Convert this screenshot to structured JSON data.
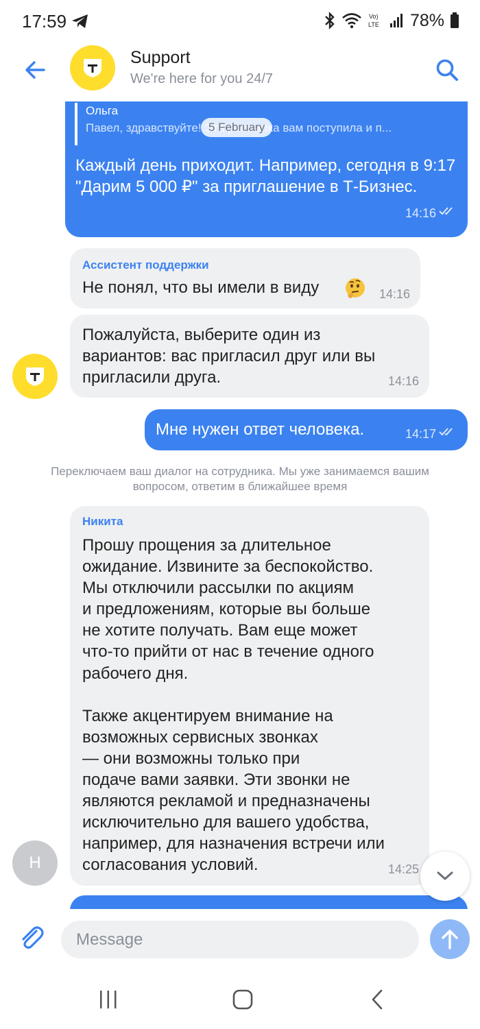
{
  "status_bar": {
    "time": "17:59",
    "battery": "78%",
    "icons": [
      "telegram-icon",
      "bluetooth-icon",
      "wifi-icon",
      "volte-icon",
      "signal-icon",
      "battery-icon"
    ]
  },
  "header": {
    "title": "Support",
    "subtitle": "We're here for you 24/7",
    "icons": [
      "back-arrow-icon",
      "shield-logo-icon",
      "search-icon"
    ]
  },
  "date_separator": "5 February",
  "messages": [
    {
      "direction": "out",
      "quote_author": "Ольга",
      "quote_text": "Павел, здравствуйте! Эта рассылка вам поступила и п...",
      "text": "Каждый день приходит. Например, сегодня в 9:17 \"Дарим 5 000 ₽\" за приглашение в Т-Бизнес.",
      "time": "14:16",
      "status": "read"
    },
    {
      "direction": "in",
      "sender": "Ассистент поддержки",
      "text": "Не понял, что вы имели в виду",
      "emoji": "thinking-face",
      "time": "14:16"
    },
    {
      "direction": "in",
      "text": "Пожалуйста, выберите один из вариантов: вас пригласил друг или вы пригласили друга.",
      "time": "14:16"
    },
    {
      "direction": "out",
      "text": "Мне нужен ответ человека.",
      "time": "14:17",
      "status": "read"
    },
    {
      "direction": "in",
      "sender": "Никита",
      "text": "Прошу прощения за длительное\nожидание. Извините за беспокойство.\nМы отключили рассылки по акциям\nи предложениям, которые вы больше\nне хотите получать. Вам еще может\nчто-то прийти от нас в течение одного\nрабочего дня.\n\nТакже акцентируем внимание на\nвозможных сервисных звонках\n— они возможны только при\nподаче вами заявки. Эти звонки не\nявляются рекламой и предназначены\nисключительно для вашего удобства,\nнапример, для назначения встречи или\nсогласования условий.",
      "avatar_letter": "Н",
      "time": "14:25"
    }
  ],
  "system_message": "Переключаем ваш диалог на сотрудника. Мы уже занимаемся вашим вопросом, ответим в ближайшее время",
  "composer": {
    "placeholder": "Message",
    "value": ""
  },
  "colors": {
    "accent": "#3b82f0",
    "incoming_bubble": "#eff0f2",
    "brand_yellow": "#ffdd2d",
    "send_button": "#8fb9f6"
  }
}
